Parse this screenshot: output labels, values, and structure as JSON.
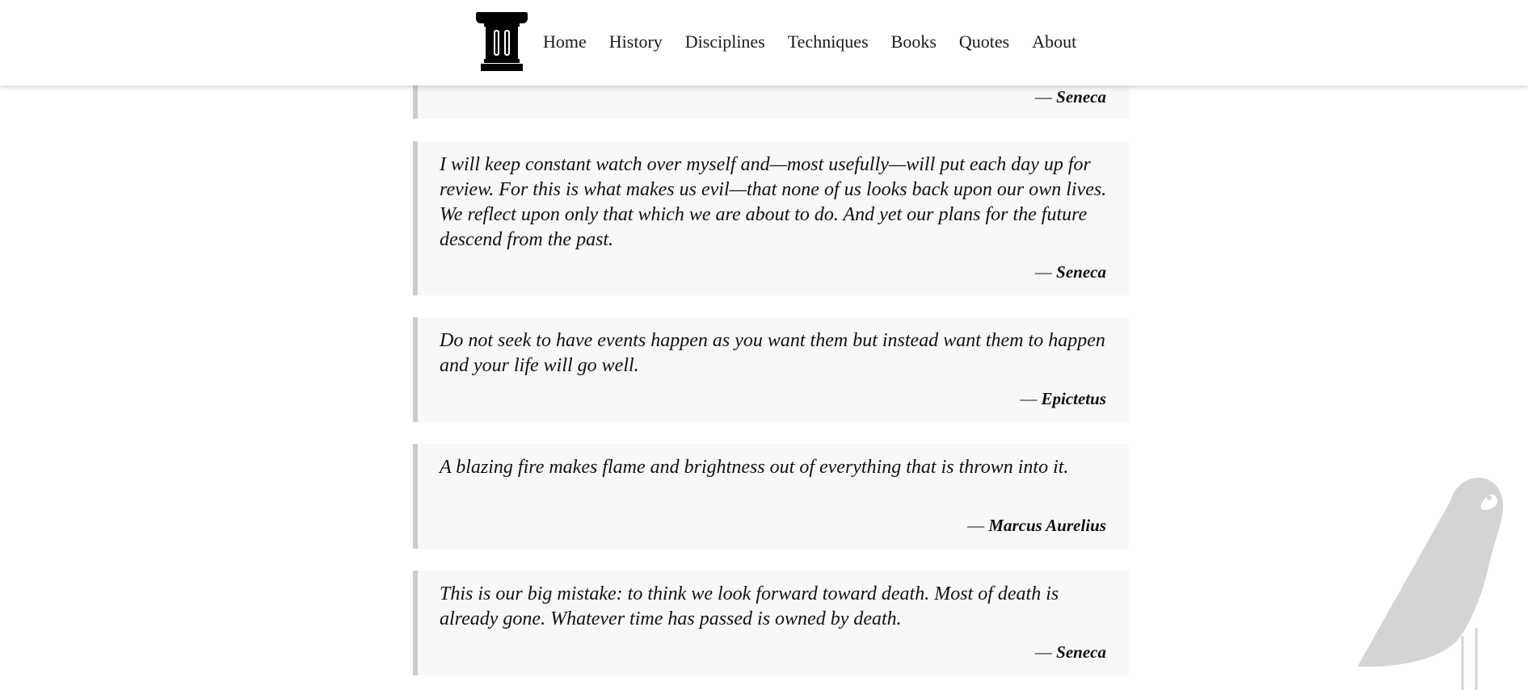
{
  "nav": {
    "logo_icon": "column-pillar-icon",
    "links": [
      {
        "label": "Home"
      },
      {
        "label": "History"
      },
      {
        "label": "Disciplines"
      },
      {
        "label": "Techniques"
      },
      {
        "label": "Books"
      },
      {
        "label": "Quotes"
      },
      {
        "label": "About"
      }
    ]
  },
  "quotes": [
    {
      "text": "",
      "dash": "—",
      "author": "Seneca"
    },
    {
      "text": "I will keep constant watch over myself and—most usefully—will put each day up for review. For this is what makes us evil—that none of us looks back upon our own lives. We reflect upon only that which we are about to do. And yet our plans for the future descend from the past.",
      "dash": "—",
      "author": "Seneca"
    },
    {
      "text": "Do not seek to have events happen as you want them but instead want them to happen and your life will go well.",
      "dash": "—",
      "author": "Epictetus"
    },
    {
      "text": "A blazing fire makes flame and brightness out of everything that is thrown into it.",
      "dash": "—",
      "author": "Marcus Aurelius"
    },
    {
      "text": "This is our big mistake: to think we look forward toward death. Most of death is already gone. Whatever time has passed is owned by death.",
      "dash": "—",
      "author": "Seneca"
    }
  ],
  "decoration": {
    "bird_icon": "bird-silhouette-icon",
    "bird_color": "#d4d4d4"
  },
  "colors": {
    "quote_background": "#f8f8f8",
    "quote_border": "#cccccc",
    "text": "#111111"
  }
}
